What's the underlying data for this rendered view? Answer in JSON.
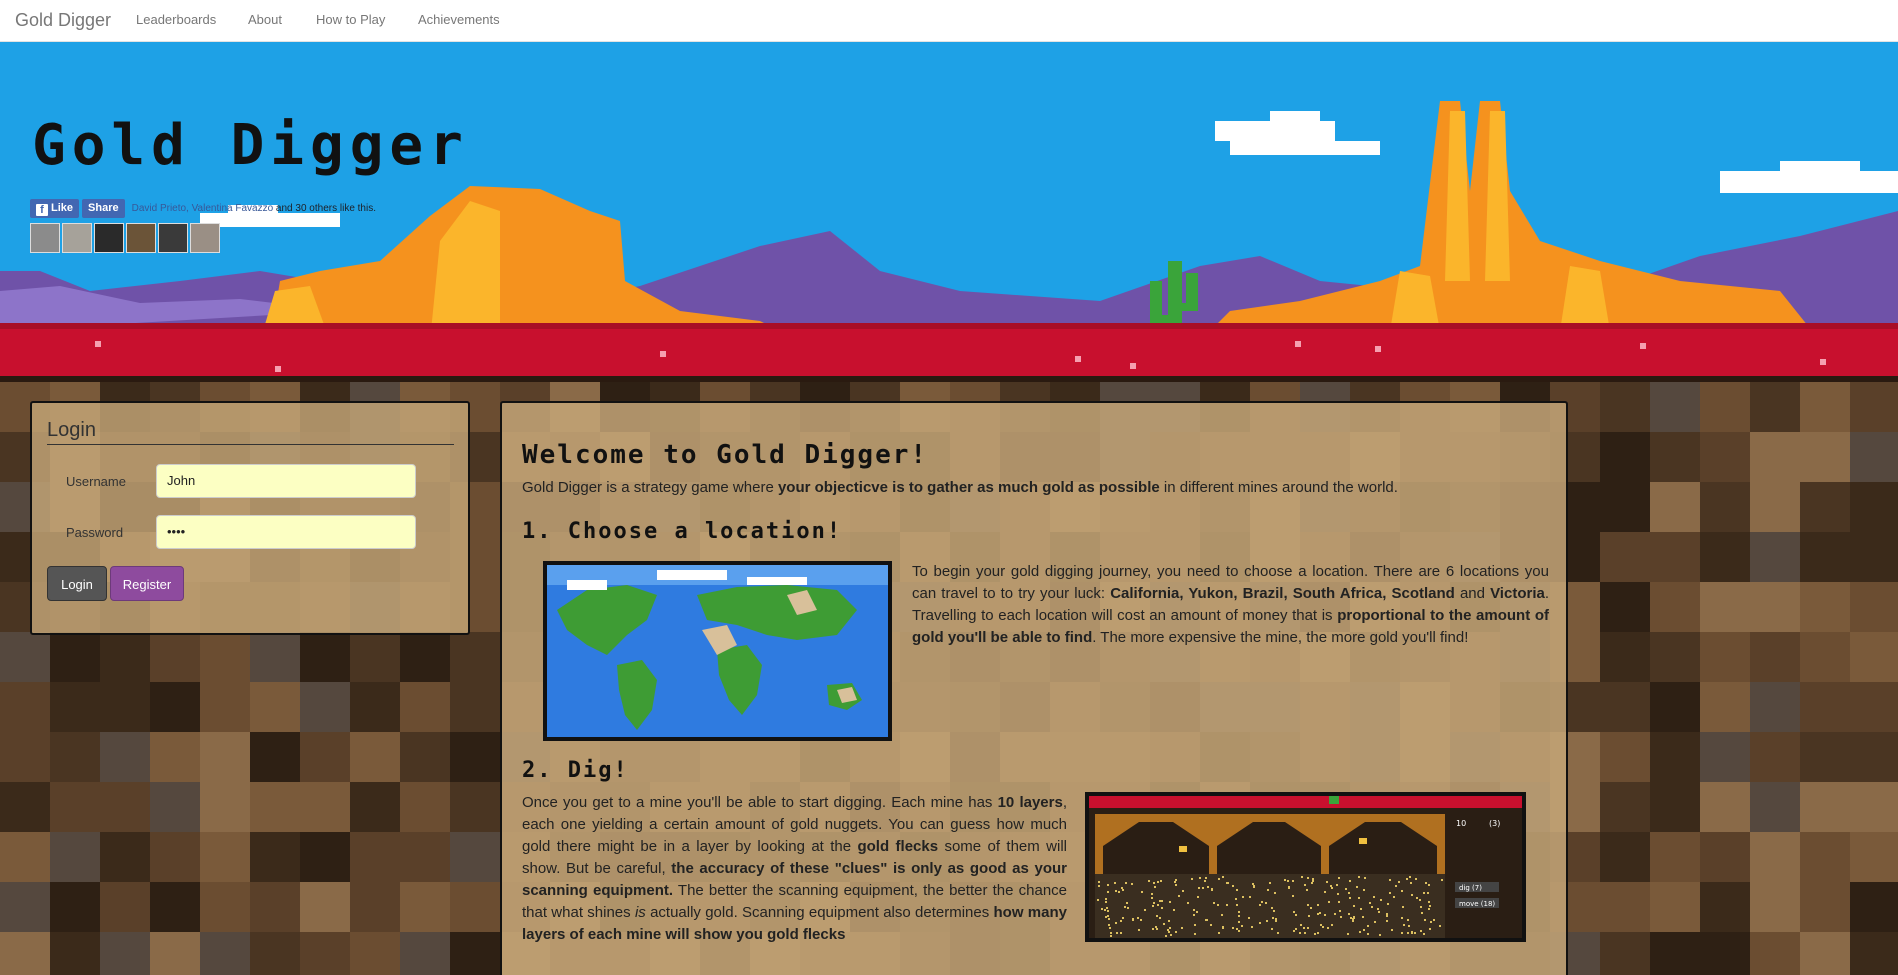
{
  "nav": {
    "brand": "Gold Digger",
    "links": [
      "Leaderboards",
      "About",
      "How to Play",
      "Achievements"
    ]
  },
  "hero": {
    "title": "Gold Digger",
    "like_label": "Like",
    "share_label": "Share",
    "fb_names": "David Prieto, Valentina Favazzo",
    "fb_suffix": " and 30 others like this."
  },
  "login": {
    "title": "Login",
    "username_label": "Username",
    "username_value": "John",
    "password_label": "Password",
    "password_value": "••••",
    "login_button": "Login",
    "register_button": "Register"
  },
  "content": {
    "welcome_title": "Welcome to Gold Digger!",
    "intro_a": "Gold Digger is a strategy game where ",
    "intro_b": "your objecticve is to gather as much gold as possible",
    "intro_c": " in different mines around the world.",
    "step1_title": "1. Choose a location!",
    "step1": [
      "To begin your gold digging journey, you need to choose a location. There are 6 locations you can travel to to try your luck: ",
      "California, Yukon, Brazil, South Africa, Scotland",
      " and ",
      "Victoria",
      ". Travelling to each location will cost an amount of money that is ",
      "proportional to the amount of gold you'll be able to find",
      ". The more expensive the mine, the more gold you'll find!"
    ],
    "step2_title": "2. Dig!",
    "step2": [
      "Once you get to a mine you'll be able to start digging. Each mine has ",
      "10 layers",
      ", each one yielding a certain amount of gold nuggets. You can guess how much gold there might be in a layer by looking at the ",
      "gold flecks",
      " some of them will show. But be careful, ",
      "the accuracy of these \"clues\" is only as good as your scanning equipment.",
      " The better the scanning equipment, the better the chance that what shines ",
      "is",
      " actually gold. Scanning equipment also determines ",
      "how many layers of each mine will show you gold flecks"
    ],
    "mine_labels": [
      "10",
      "(3)",
      "dig (7)",
      "move (18)"
    ]
  },
  "colors": {
    "sky": "#1ea1e6",
    "ground": "#c8102e",
    "rock_orange": "#f5921e",
    "rock_yellow": "#fbb52b",
    "mountain_purple": "#7a5db3",
    "login_button": "#555555",
    "register_button": "#8e4b9e"
  }
}
